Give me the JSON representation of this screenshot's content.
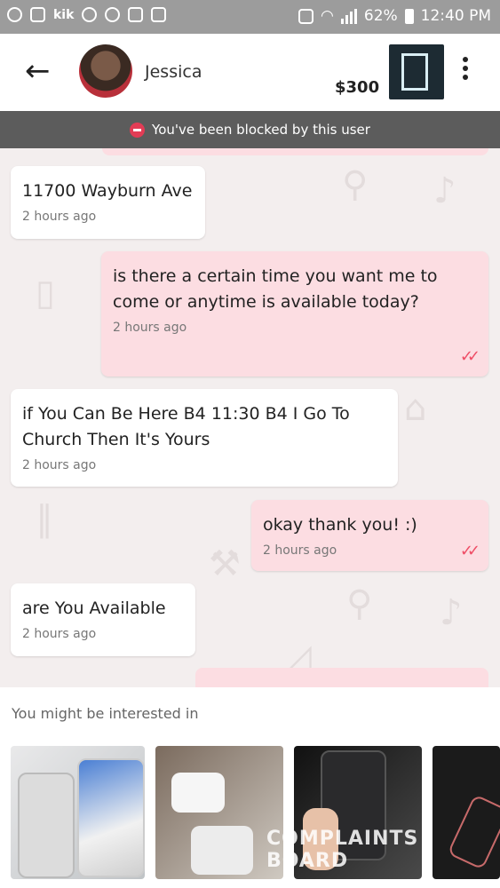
{
  "status_bar": {
    "carrier_label": "kik",
    "battery": "62%",
    "time": "12:40 PM"
  },
  "header": {
    "name": "Jessica",
    "price": "$300"
  },
  "blocked_banner": {
    "text": "You've been blocked by this user"
  },
  "messages": [
    {
      "direction": "in",
      "text": "11700 Wayburn Ave",
      "time": "2 hours ago"
    },
    {
      "direction": "out",
      "text": "is there a certain time you want me to come or anytime is available today?",
      "time": "2 hours ago"
    },
    {
      "direction": "in",
      "text": "if You Can Be Here B4 11:30 B4 I Go To Church Then It's Yours",
      "time": "2 hours ago"
    },
    {
      "direction": "out",
      "text": "okay thank you! :)",
      "time": "2 hours ago"
    },
    {
      "direction": "in",
      "text": "are You Available",
      "time": "2 hours ago"
    }
  ],
  "suggestions": {
    "title": "You might be interested in",
    "watermark": "COMPLAINTS BOARD"
  },
  "colors": {
    "outgoing_bubble": "#fcdde2",
    "incoming_bubble": "#ffffff",
    "read_check": "#ef4d66",
    "banner": "#5c5c5c"
  }
}
